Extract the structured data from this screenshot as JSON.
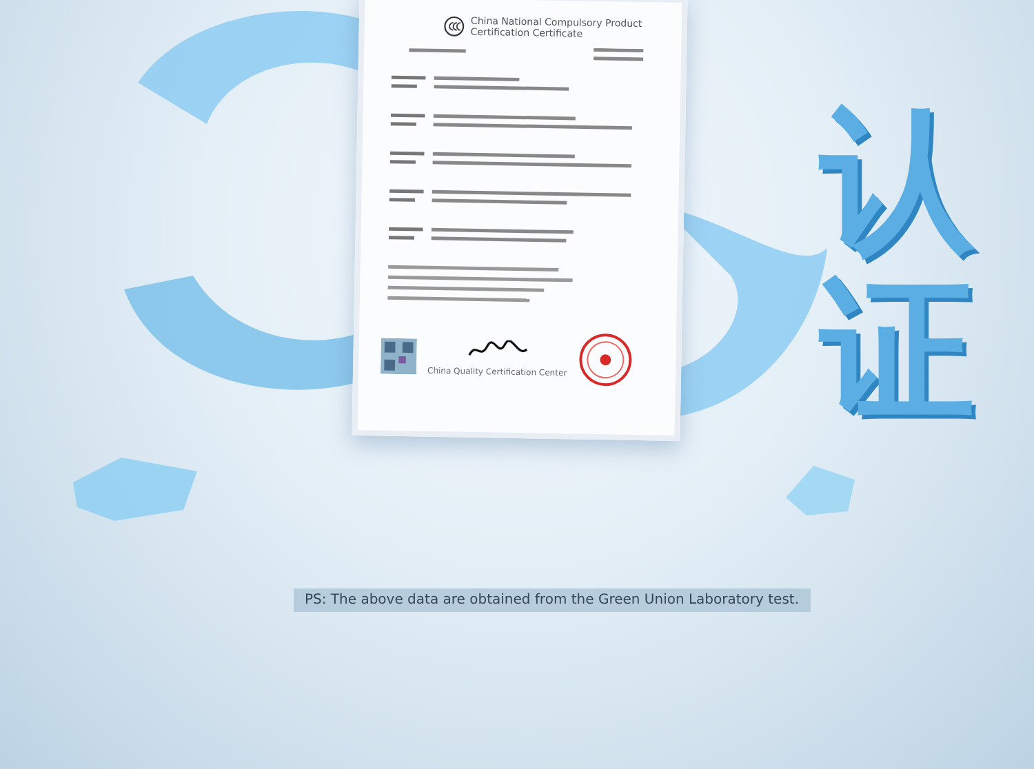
{
  "headline": {
    "chinese": "认证"
  },
  "certificate": {
    "title_lines": [
      "China National Compulsory Product",
      "Certification Certificate"
    ],
    "issuer": "China Quality Certification Center"
  },
  "note": "PS: The above data are obtained from the Green Union Laboratory test."
}
